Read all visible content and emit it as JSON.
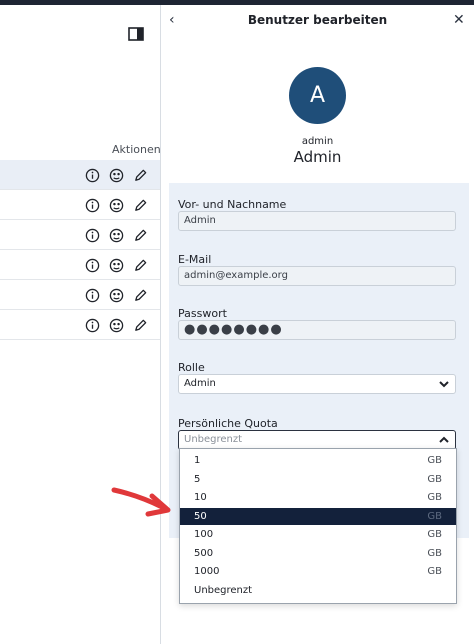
{
  "header": {
    "title": "Benutzer bearbeiten",
    "back_glyph": "‹",
    "close_glyph": "✕"
  },
  "list": {
    "actions_header": "Aktionen",
    "rows": [
      {
        "selected": true
      },
      {
        "selected": false
      },
      {
        "selected": false
      },
      {
        "selected": false
      },
      {
        "selected": false
      },
      {
        "selected": false
      }
    ]
  },
  "user": {
    "initial": "A",
    "username": "admin",
    "display_name": "Admin"
  },
  "form": {
    "name_label": "Vor- und Nachname",
    "name_value": "Admin",
    "email_label": "E-Mail",
    "email_value": "admin@example.org",
    "password_label": "Passwort",
    "password_value": "●●●●●●●●",
    "role_label": "Rolle",
    "role_value": "Admin",
    "quota_label": "Persönliche Quota",
    "quota_value": "Unbegrenzt"
  },
  "quota_options": [
    {
      "value": "1",
      "unit": "GB"
    },
    {
      "value": "5",
      "unit": "GB"
    },
    {
      "value": "10",
      "unit": "GB"
    },
    {
      "value": "50",
      "unit": "GB",
      "selected": true
    },
    {
      "value": "100",
      "unit": "GB"
    },
    {
      "value": "500",
      "unit": "GB"
    },
    {
      "value": "1000",
      "unit": "GB"
    },
    {
      "value": "Unbegrenzt",
      "unit": ""
    }
  ],
  "colors": {
    "accent": "#1f4e79",
    "selected_option": "#13213b",
    "annotation_arrow": "#e0383a"
  },
  "icons": [
    "info-icon",
    "impersonate-icon",
    "edit-pencil-icon",
    "sidebar-toggle-icon",
    "chevron-down-icon",
    "chevron-up-icon",
    "annotation-arrow"
  ]
}
